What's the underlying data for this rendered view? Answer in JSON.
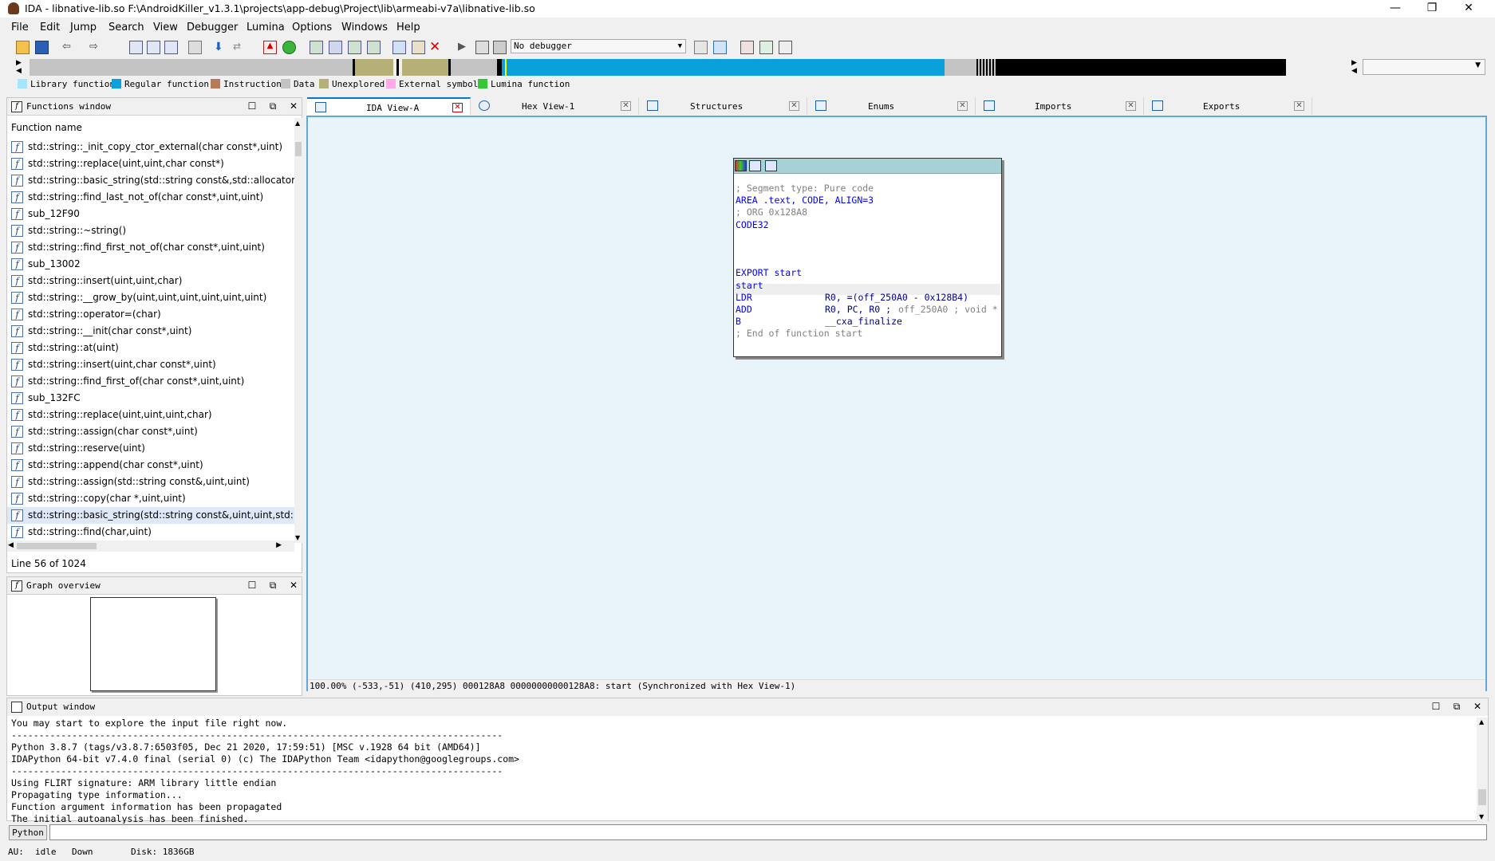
{
  "window": {
    "title": "IDA - libnative-lib.so F:\\AndroidKiller_v1.3.1\\projects\\app-debug\\Project\\lib\\armeabi-v7a\\libnative-lib.so",
    "minimize": "—",
    "restore": "❐",
    "close": "✕"
  },
  "menu": [
    "File",
    "Edit",
    "Jump",
    "Search",
    "View",
    "Debugger",
    "Lumina",
    "Options",
    "Windows",
    "Help"
  ],
  "toolbar": {
    "debugger_select": "No debugger"
  },
  "legend": [
    {
      "label": "Library function",
      "color": "#a5e5ff"
    },
    {
      "label": "Regular function",
      "color": "#0aa0dc"
    },
    {
      "label": "Instruction",
      "color": "#b97a57"
    },
    {
      "label": "Data",
      "color": "#c3c3c3"
    },
    {
      "label": "Unexplored",
      "color": "#b4b078"
    },
    {
      "label": "External symbol",
      "color": "#ffaae6"
    },
    {
      "label": "Lumina function",
      "color": "#34c834"
    }
  ],
  "functions_window": {
    "title": "Functions window",
    "column": "Function name",
    "items": [
      "std::string::_init_copy_ctor_external(char const*,uint)",
      "std::string::replace(uint,uint,char const*)",
      "std::string::basic_string(std::string const&,std::allocator<c",
      "std::string::find_last_not_of(char const*,uint,uint)",
      "sub_12F90",
      "std::string::~string()",
      "std::string::find_first_not_of(char const*,uint,uint)",
      "sub_13002",
      "std::string::insert(uint,uint,char)",
      "std::string::__grow_by(uint,uint,uint,uint,uint,uint)",
      "std::string::operator=(char)",
      "std::string::__init(char const*,uint)",
      "std::string::at(uint)",
      "std::string::insert(uint,char const*,uint)",
      "std::string::find_first_of(char const*,uint,uint)",
      "sub_132FC",
      "std::string::replace(uint,uint,uint,char)",
      "std::string::assign(char const*,uint)",
      "std::string::reserve(uint)",
      "std::string::append(char const*,uint)",
      "std::string::assign(std::string const&,uint,uint)",
      "std::string::copy(char *,uint,uint)",
      "std::string::basic_string(std::string const&,uint,uint,std::allo",
      "std::string::find(char,uint)"
    ],
    "status": "Line 56 of 1024"
  },
  "graph_overview": {
    "title": "Graph overview"
  },
  "tabs": [
    {
      "label": "IDA View-A",
      "active": true
    },
    {
      "label": "Hex View-1",
      "active": false
    },
    {
      "label": "Structures",
      "active": false
    },
    {
      "label": "Enums",
      "active": false
    },
    {
      "label": "Imports",
      "active": false
    },
    {
      "label": "Exports",
      "active": false
    }
  ],
  "disasm": {
    "lines": [
      {
        "text": "; Segment type: Pure code",
        "kind": "comment"
      },
      {
        "text": "AREA .text, CODE, ALIGN=3",
        "kind": "blue"
      },
      {
        "text": "; ORG 0x128A8",
        "kind": "comment"
      },
      {
        "text": "CODE32",
        "kind": "blue"
      },
      {
        "text": "",
        "kind": "blank"
      },
      {
        "text": "",
        "kind": "blank"
      },
      {
        "text": "",
        "kind": "blank"
      },
      {
        "text": "EXPORT start",
        "kind": "blue"
      },
      {
        "text": "start",
        "kind": "blue"
      }
    ],
    "instructions": [
      {
        "mnemonic": "LDR",
        "operands": "R0, =(off_250A0 - 0x128B4)",
        "comment": ""
      },
      {
        "mnemonic": "ADD",
        "operands": "R0, PC, R0 ;",
        "comment": "off_250A0 ; void *"
      },
      {
        "mnemonic": "B",
        "operands": "__cxa_finalize",
        "comment": ""
      }
    ],
    "end_comment": "; End of function start",
    "status": "100.00% (-533,-51) (410,295) 000128A8 00000000000128A8: start (Synchronized with Hex View-1)"
  },
  "output_window": {
    "title": "Output window",
    "lines": [
      "You may start to explore the input file right now.",
      "-----------------------------------------------------------------------------------------",
      "Python 3.8.7 (tags/v3.8.7:6503f05, Dec 21 2020, 17:59:51) [MSC v.1928 64 bit (AMD64)]",
      "IDAPython 64-bit v7.4.0 final (serial 0) (c) The IDAPython Team <idapython@googlegroups.com>",
      "-----------------------------------------------------------------------------------------",
      "Using FLIRT signature: ARM library little endian",
      "Propagating type information...",
      "Function argument information has been propagated",
      "The initial autoanalysis has been finished."
    ]
  },
  "python_bar": {
    "button": "Python",
    "input_value": ""
  },
  "statusbar": {
    "au": "AU:",
    "state": "idle",
    "direction": "Down",
    "disk": "Disk: 1836GB"
  }
}
